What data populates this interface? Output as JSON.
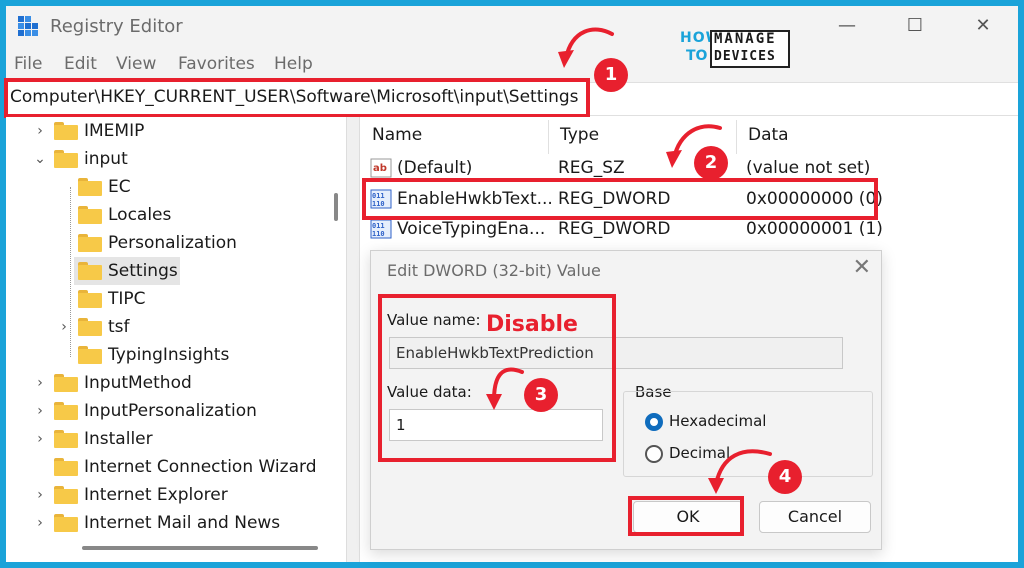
{
  "window": {
    "title": "Registry Editor",
    "minimize": "—",
    "maximize": "☐",
    "close": "✕"
  },
  "menu": [
    "File",
    "Edit",
    "View",
    "Favorites",
    "Help"
  ],
  "address": "Computer\\HKEY_CURRENT_USER\\Software\\Microsoft\\input\\Settings",
  "logo": {
    "how": "HOW",
    "to": "TO",
    "manage": "MANAGE",
    "devices": "DEVICES"
  },
  "tree": [
    {
      "label": "IMEMIP",
      "chevron": "›"
    },
    {
      "label": "input",
      "chevron": "⌄"
    },
    {
      "label": "EC",
      "chevron": ""
    },
    {
      "label": "Locales",
      "chevron": ""
    },
    {
      "label": "Personalization",
      "chevron": ""
    },
    {
      "label": "Settings",
      "chevron": ""
    },
    {
      "label": "TIPC",
      "chevron": ""
    },
    {
      "label": "tsf",
      "chevron": "›"
    },
    {
      "label": "TypingInsights",
      "chevron": ""
    },
    {
      "label": "InputMethod",
      "chevron": "›"
    },
    {
      "label": "InputPersonalization",
      "chevron": "›"
    },
    {
      "label": "Installer",
      "chevron": "›"
    },
    {
      "label": "Internet Connection Wizard",
      "chevron": ""
    },
    {
      "label": "Internet Explorer",
      "chevron": "›"
    },
    {
      "label": "Internet Mail and News",
      "chevron": "›"
    }
  ],
  "columns": {
    "name": "Name",
    "type": "Type",
    "data": "Data"
  },
  "values": [
    {
      "icon": "ab",
      "name": "(Default)",
      "type": "REG_SZ",
      "data": "(value not set)"
    },
    {
      "icon": "dword",
      "name": "EnableHwkbText...",
      "type": "REG_DWORD",
      "data": "0x00000000 (0)"
    },
    {
      "icon": "dword",
      "name": "VoiceTypingEna...",
      "type": "REG_DWORD",
      "data": "0x00000001 (1)"
    }
  ],
  "dialog": {
    "title": "Edit DWORD (32-bit) Value",
    "close": "✕",
    "value_name_label": "Value name:",
    "value_name": "EnableHwkbTextPrediction",
    "value_data_label": "Value data:",
    "value_data": "1",
    "base_label": "Base",
    "hex_label": "Hexadecimal",
    "dec_label": "Decimal",
    "ok": "OK",
    "cancel": "Cancel"
  },
  "annotations": {
    "disable": "Disable",
    "steps": [
      "1",
      "2",
      "3",
      "4"
    ],
    "color": "#e8202e"
  }
}
